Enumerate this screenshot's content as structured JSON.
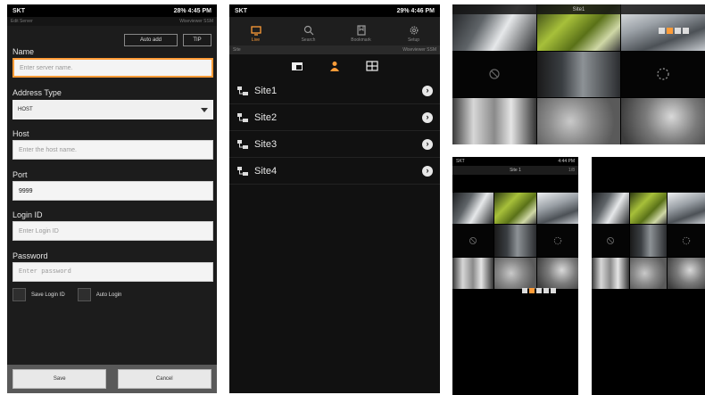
{
  "phone1": {
    "status_carrier": "SKT",
    "status_battery": "28%",
    "status_time": "4:45 PM",
    "subbar_left": "Edit Server",
    "subbar_right": "Wiseviewer SSM",
    "auto_add_label": "Auto add",
    "tip_label": "TIP",
    "name_label": "Name",
    "name_placeholder": "Enter server name.",
    "address_type_label": "Address Type",
    "address_type_value": "HOST",
    "host_label": "Host",
    "host_placeholder": "Enter the host name.",
    "port_label": "Port",
    "port_value": "9999",
    "login_id_label": "Login ID",
    "login_id_placeholder": "Enter Login ID",
    "password_label": "Password",
    "password_placeholder": "Enter password",
    "save_login_id_label": "Save Login ID",
    "auto_login_label": "Auto Login",
    "save_label": "Save",
    "cancel_label": "Cancel"
  },
  "phone2": {
    "status_carrier": "SKT",
    "status_battery": "29%",
    "status_time": "4:46 PM",
    "tabs": [
      {
        "label": "Live",
        "icon": "monitor-icon",
        "active": true
      },
      {
        "label": "Search",
        "icon": "search-icon",
        "active": false
      },
      {
        "label": "Bookmark",
        "icon": "bookmark-icon",
        "active": false
      },
      {
        "label": "Setup",
        "icon": "gear-icon",
        "active": false
      }
    ],
    "site_bar_left": "Site",
    "site_bar_right": "Wiseviewer SSM",
    "sites": [
      "Site1",
      "Site2",
      "Site3",
      "Site4"
    ]
  },
  "grid_large": {
    "title": "Site1"
  },
  "grid_small": {
    "status_carrier": "SKT",
    "status_time": "4:44 PM",
    "title": "Site 1",
    "title_right": "1/8"
  },
  "colors": {
    "accent": "#ff9c38",
    "background": "#111111",
    "field": "#f4f4f4"
  }
}
